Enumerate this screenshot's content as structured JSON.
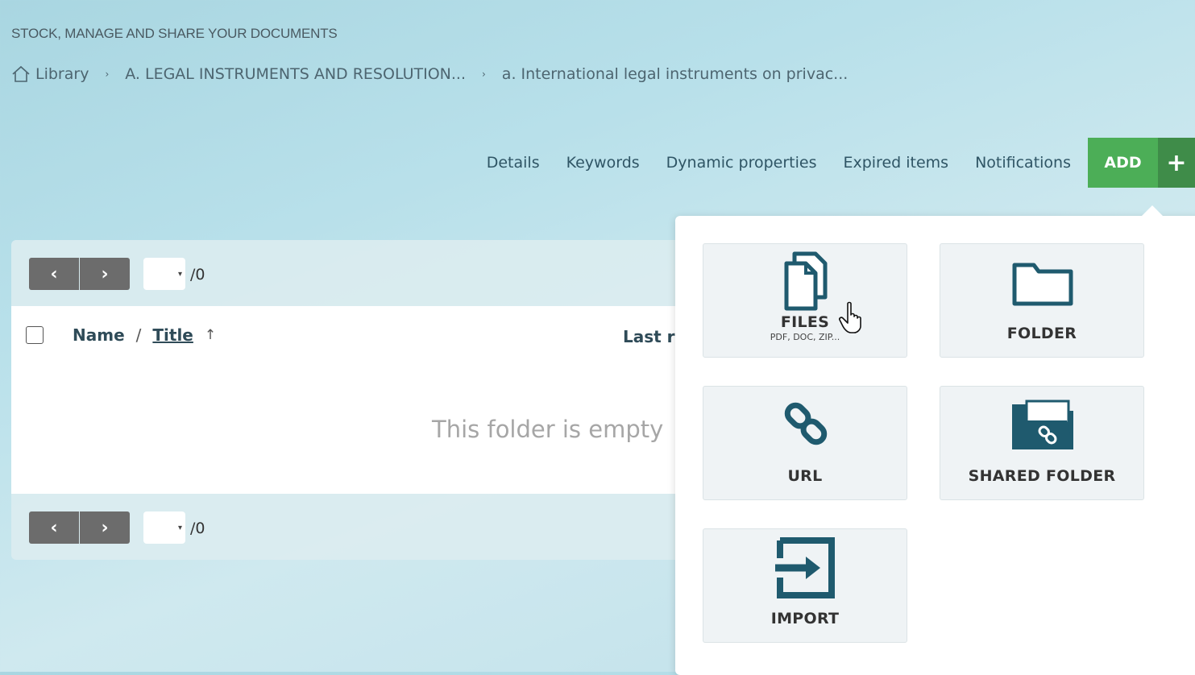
{
  "header": {
    "tagline": "STOCK, MANAGE AND SHARE YOUR DOCUMENTS"
  },
  "breadcrumb": {
    "items": [
      "Library",
      "A. LEGAL INSTRUMENTS AND RESOLUTION...",
      "a. International legal instruments on privac..."
    ],
    "separator": "›"
  },
  "topnav": {
    "items": [
      "Details",
      "Keywords",
      "Dynamic properties",
      "Expired items",
      "Notifications"
    ],
    "add_label": "ADD",
    "add_plus": "+"
  },
  "pager": {
    "prev": "‹",
    "next": "›",
    "total": "/0"
  },
  "list": {
    "columns": {
      "name": "Name",
      "slash": "/",
      "title": "Title",
      "sort": "↑",
      "last": "Last r"
    },
    "empty_message": "This folder is empty"
  },
  "add_menu": {
    "files": {
      "label": "FILES",
      "sub": "PDF, DOC, ZIP..."
    },
    "folder": {
      "label": "FOLDER"
    },
    "url": {
      "label": "URL"
    },
    "shared_folder": {
      "label": "SHARED FOLDER"
    },
    "import": {
      "label": "IMPORT"
    }
  },
  "colors": {
    "add_green": "#4cae57",
    "add_dark_green": "#3f8c49",
    "icon_teal": "#1f5a6e"
  }
}
